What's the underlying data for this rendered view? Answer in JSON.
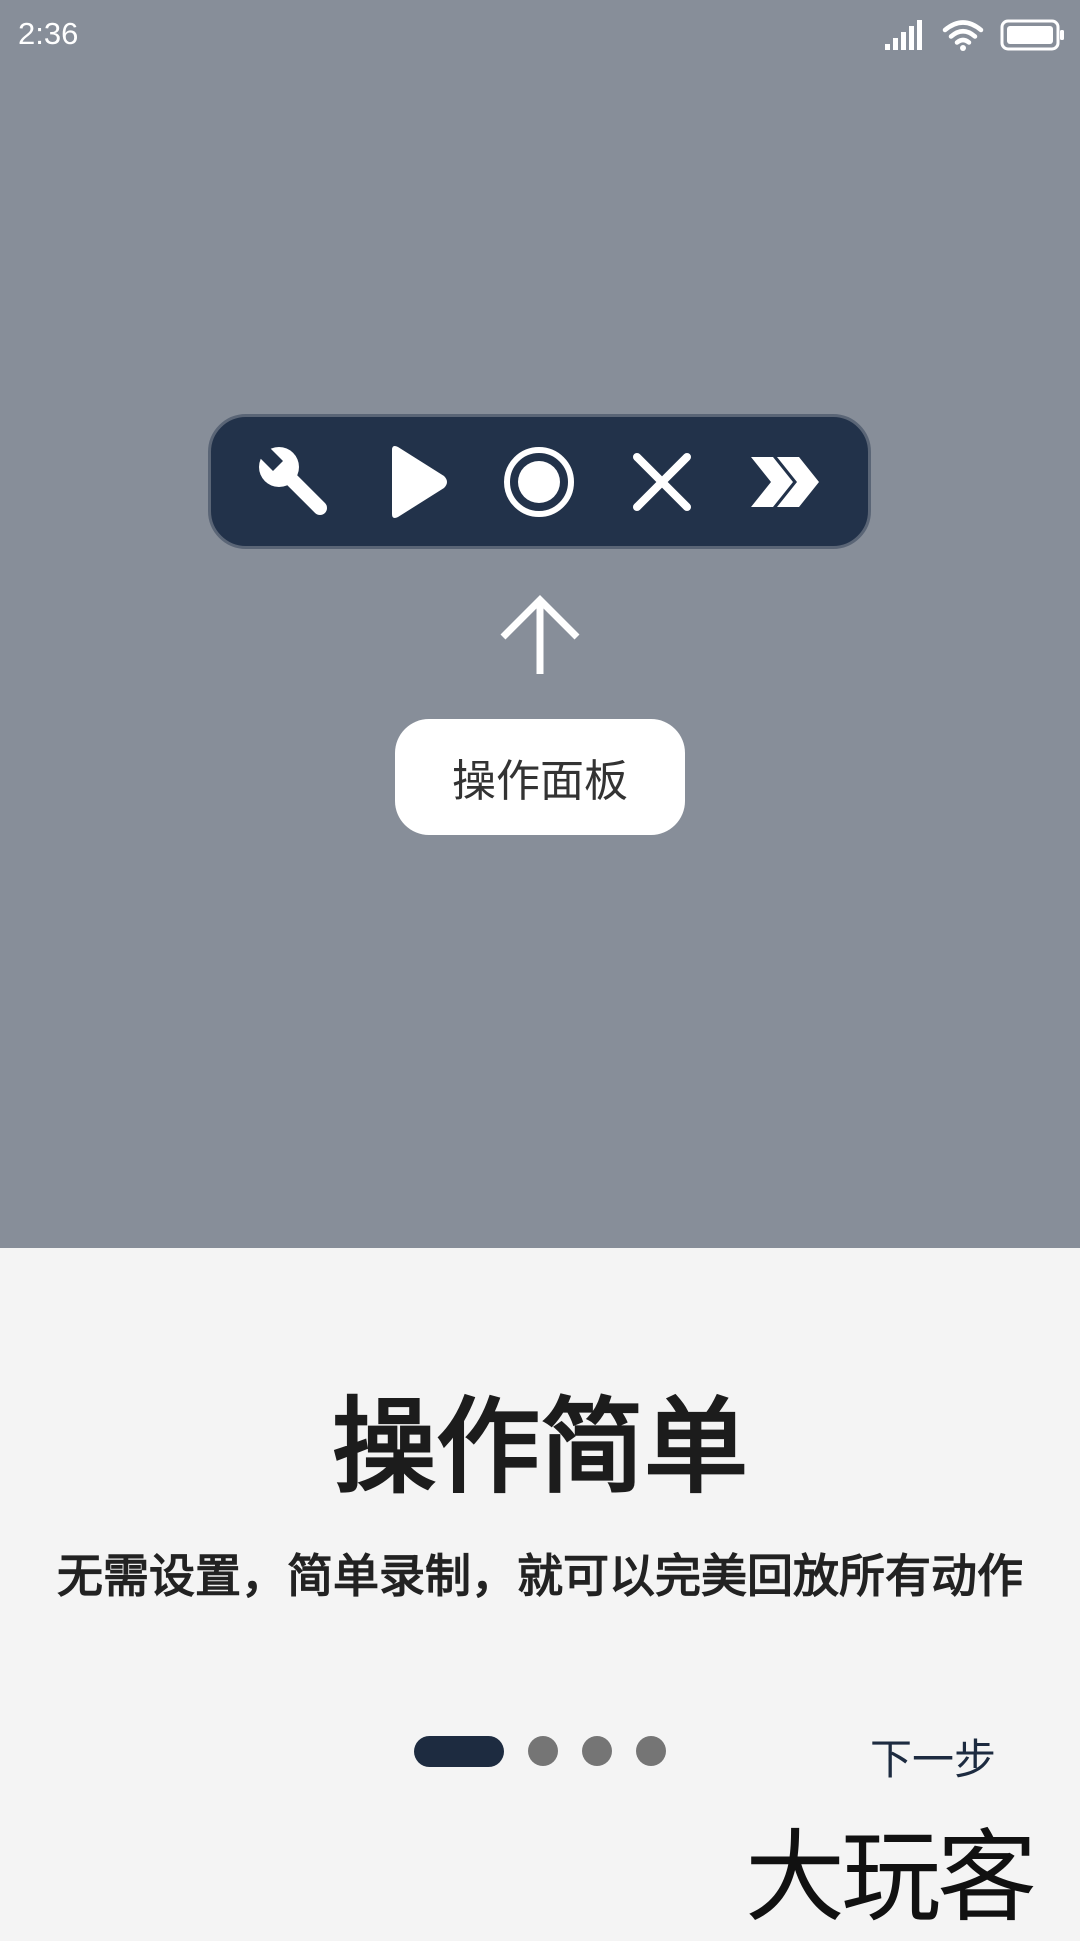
{
  "status_bar": {
    "time": "2:36",
    "icons": [
      "signal-icon",
      "wifi-icon",
      "battery-icon"
    ]
  },
  "panel": {
    "buttons": [
      "wrench-icon",
      "play-icon",
      "record-icon",
      "close-icon",
      "double-chevron-right-icon"
    ]
  },
  "tooltip": {
    "label": "操作面板"
  },
  "content": {
    "title": "操作简单",
    "subtitle": "无需设置，简单录制，就可以完美回放所有动作"
  },
  "pager": {
    "total": 4,
    "current": 1
  },
  "next_label": "下一步",
  "watermark": "大玩客",
  "colors": {
    "overlay": "#878e99",
    "panel": "#22324a",
    "accent": "#1d2b40",
    "background": "#f4f4f4"
  }
}
